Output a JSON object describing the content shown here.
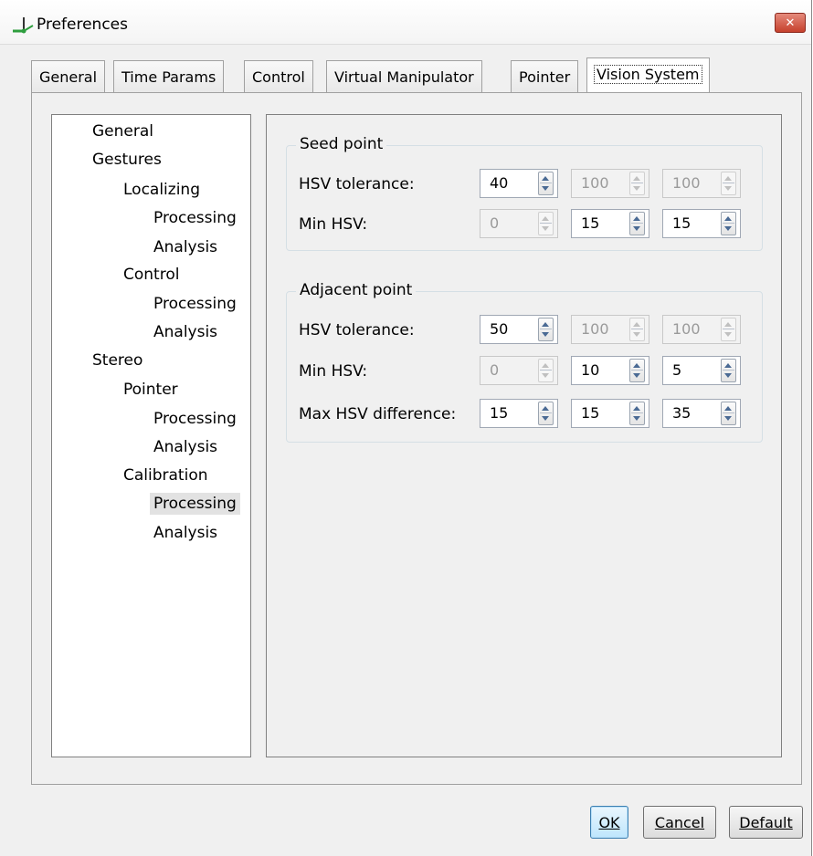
{
  "window": {
    "title": "Preferences",
    "close_label": "✕"
  },
  "tabs": [
    {
      "label": "General"
    },
    {
      "label": "Time Params"
    },
    {
      "label": "Control"
    },
    {
      "label": "Virtual Manipulator"
    },
    {
      "label": "Pointer"
    },
    {
      "label": "Vision System",
      "active": true
    }
  ],
  "tree": [
    {
      "label": "General",
      "level": 0
    },
    {
      "label": "Gestures",
      "level": 0
    },
    {
      "label": "Localizing",
      "level": 1
    },
    {
      "label": "Processing",
      "level": 2
    },
    {
      "label": "Analysis",
      "level": 2
    },
    {
      "label": "Control",
      "level": 1
    },
    {
      "label": "Processing",
      "level": 2
    },
    {
      "label": "Analysis",
      "level": 2
    },
    {
      "label": "Stereo",
      "level": 0
    },
    {
      "label": "Pointer",
      "level": 1
    },
    {
      "label": "Processing",
      "level": 2
    },
    {
      "label": "Analysis",
      "level": 2
    },
    {
      "label": "Calibration",
      "level": 1
    },
    {
      "label": "Processing",
      "level": 2,
      "selected": true
    },
    {
      "label": "Analysis",
      "level": 2
    }
  ],
  "seed": {
    "title": "Seed point",
    "hsv_tolerance": {
      "label": "HSV tolerance:",
      "values": [
        "40",
        "100",
        "100"
      ],
      "enabled": [
        true,
        false,
        false
      ]
    },
    "min_hsv": {
      "label": "Min HSV:",
      "values": [
        "0",
        "15",
        "15"
      ],
      "enabled": [
        false,
        true,
        true
      ]
    }
  },
  "adjacent": {
    "title": "Adjacent point",
    "hsv_tolerance": {
      "label": "HSV tolerance:",
      "values": [
        "50",
        "100",
        "100"
      ],
      "enabled": [
        true,
        false,
        false
      ]
    },
    "min_hsv": {
      "label": "Min HSV:",
      "values": [
        "0",
        "10",
        "5"
      ],
      "enabled": [
        false,
        true,
        true
      ]
    },
    "max_hsv_difference": {
      "label": "Max HSV difference:",
      "values": [
        "15",
        "15",
        "35"
      ],
      "enabled": [
        true,
        true,
        true
      ]
    }
  },
  "buttons": {
    "ok": "OK",
    "cancel": "Cancel",
    "default": "Default"
  }
}
